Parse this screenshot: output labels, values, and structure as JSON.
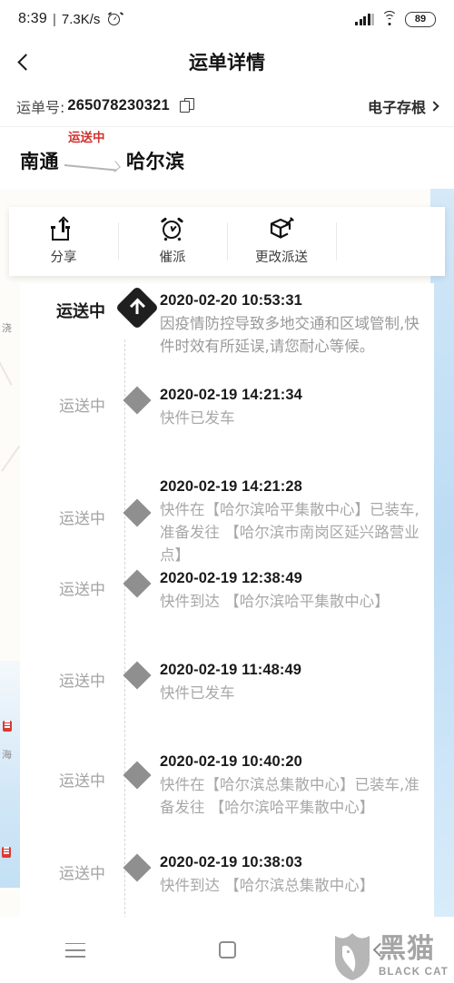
{
  "statusbar": {
    "time": "8:39",
    "separator": "|",
    "network_speed": "7.3K/s",
    "alarm_icon": "alarm-clock-icon",
    "signal_icon": "signal-bars-icon",
    "wifi_icon": "wifi-icon",
    "battery_level": "89"
  },
  "titlebar": {
    "back_icon": "chevron-left-icon",
    "title": "运单详情"
  },
  "waybill": {
    "label": "运单号:",
    "number": "265078230321",
    "copy_icon": "copy-icon",
    "stub_label": "电子存根",
    "stub_chevron": "chevron-right-icon"
  },
  "route": {
    "origin": "南通",
    "destination": "哈尔滨",
    "status": "运送中",
    "status_color": "#d0312d",
    "arrow_icon": "arrow-right-icon"
  },
  "actions": [
    {
      "icon": "share-icon",
      "label": "分享"
    },
    {
      "icon": "alarm-clock-icon",
      "label": "催派"
    },
    {
      "icon": "package-edit-icon",
      "label": "更改派送"
    }
  ],
  "timeline": [
    {
      "status": "运送中",
      "time": "2020-02-20 10:53:31",
      "text": "因疫情防控导致多地交通和区域管制,快件时效有所延误,请您耐心等候。",
      "active": true,
      "marker_icon": "arrow-up-diamond-icon"
    },
    {
      "status": "运送中",
      "time": "2020-02-19 14:21:34",
      "text": "快件已发车",
      "active": false,
      "marker_icon": "diamond-icon"
    },
    {
      "status": "运送中",
      "time": "2020-02-19 14:21:28",
      "text": "快件在【哈尔滨哈平集散中心】已装车,准备发往 【哈尔滨市南岗区延兴路营业点】",
      "active": false,
      "marker_icon": "diamond-icon"
    },
    {
      "status": "运送中",
      "time": "2020-02-19 12:38:49",
      "text": "快件到达 【哈尔滨哈平集散中心】",
      "active": false,
      "marker_icon": "diamond-icon"
    },
    {
      "status": "运送中",
      "time": "2020-02-19 11:48:49",
      "text": "快件已发车",
      "active": false,
      "marker_icon": "diamond-icon"
    },
    {
      "status": "运送中",
      "time": "2020-02-19 10:40:20",
      "text": "快件在【哈尔滨总集散中心】已装车,准备发往 【哈尔滨哈平集散中心】",
      "active": false,
      "marker_icon": "diamond-icon"
    },
    {
      "status": "运送中",
      "time": "2020-02-19 10:38:03",
      "text": "快件到达 【哈尔滨总集散中心】",
      "active": false,
      "marker_icon": "diamond-icon"
    }
  ],
  "map": {
    "labels": [
      "浇",
      "海"
    ]
  },
  "navbar": {
    "recents_icon": "menu-icon",
    "home_icon": "home-square-icon",
    "back_icon": "chevron-left-icon"
  },
  "watermark": {
    "shield_icon": "black-cat-shield-icon",
    "cn": "黑猫",
    "en": "BLACK CAT"
  }
}
